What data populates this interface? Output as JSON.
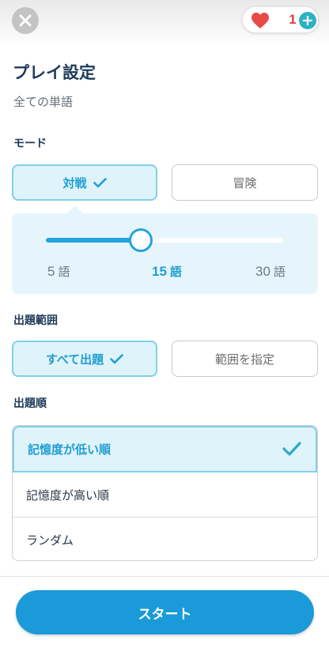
{
  "header": {
    "close_icon": "close-icon",
    "lives": {
      "count": "1",
      "heart_icon": "heart-icon",
      "plus_icon": "plus-icon"
    }
  },
  "title": "プレイ設定",
  "subtitle": "全ての単語",
  "mode": {
    "label": "モード",
    "options": [
      {
        "label": "対戦",
        "selected": true
      },
      {
        "label": "冒険",
        "selected": false
      }
    ]
  },
  "word_count": {
    "min": 5,
    "max": 30,
    "value": 15,
    "min_label": "5",
    "value_label": "15",
    "max_label": "30",
    "unit": "語"
  },
  "range": {
    "label": "出題範囲",
    "options": [
      {
        "label": "すべて出題",
        "selected": true
      },
      {
        "label": "範囲を指定",
        "selected": false
      }
    ]
  },
  "order": {
    "label": "出題順",
    "options": [
      {
        "label": "記憶度が低い順",
        "selected": true
      },
      {
        "label": "記憶度が高い順",
        "selected": false
      },
      {
        "label": "ランダム",
        "selected": false
      }
    ]
  },
  "start_label": "スタート",
  "colors": {
    "accent": "#1a9ad8",
    "selected_bg": "#dff3fb",
    "selected_border": "#7fd0ea",
    "heart": "#e84a45",
    "plus": "#2db2c4"
  }
}
